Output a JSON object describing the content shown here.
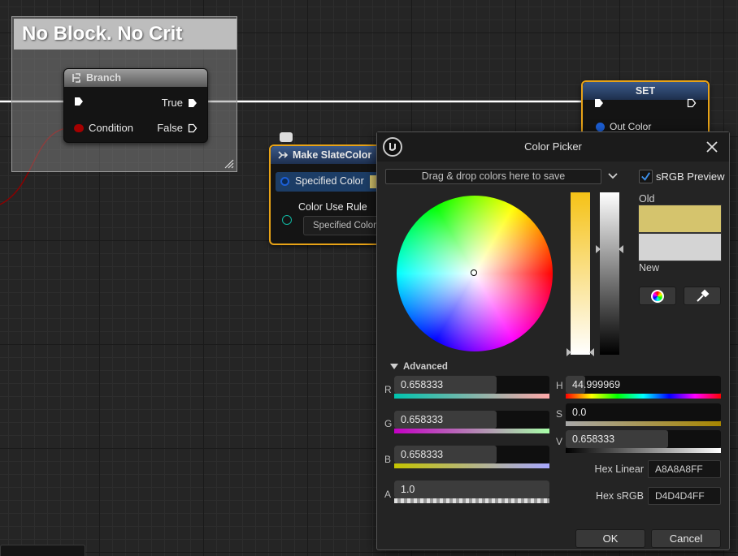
{
  "graph": {
    "comment_title": "No Block. No Crit",
    "branch": {
      "title": "Branch",
      "true_label": "True",
      "condition_label": "Condition",
      "false_label": "False"
    },
    "set_node": {
      "title": "SET",
      "out_label": "Out Color"
    },
    "make_slate": {
      "title": "Make SlateColor",
      "specified_color_label": "Specified Color",
      "color_use_rule_label": "Color Use Rule",
      "color_use_rule_value": "Specified Color"
    }
  },
  "color_picker": {
    "title": "Color Picker",
    "dropzone_text": "Drag & drop colors here to save",
    "srgb_preview_label": "sRGB Preview",
    "srgb_preview_checked": true,
    "old_label": "Old",
    "new_label": "New",
    "old_color": "#d5c46d",
    "new_color": "#d4d4d4",
    "advanced_label": "Advanced",
    "channels": {
      "r": {
        "label": "R",
        "value": "0.658333",
        "level": 0.658333
      },
      "g": {
        "label": "G",
        "value": "0.658333",
        "level": 0.658333
      },
      "b": {
        "label": "B",
        "value": "0.658333",
        "level": 0.658333
      },
      "a": {
        "label": "A",
        "value": "1.0",
        "level": 1.0
      },
      "h": {
        "label": "H",
        "value": "44.999969",
        "level": 0.125
      },
      "s": {
        "label": "S",
        "value": "0.0",
        "level": 0.0
      },
      "v": {
        "label": "V",
        "value": "0.658333",
        "level": 0.658333
      }
    },
    "hex_linear_label": "Hex Linear",
    "hex_linear_value": "A8A8A8FF",
    "hex_srgb_label": "Hex sRGB",
    "hex_srgb_value": "D4D4D4FF",
    "ok_label": "OK",
    "cancel_label": "Cancel",
    "icons": [
      "ue-logo-icon",
      "close-icon",
      "chevron-down-icon",
      "checkmark-icon",
      "color-wheel-icon",
      "eyedropper-icon",
      "triangle-down-icon"
    ],
    "accent_color": "#e8a317"
  }
}
